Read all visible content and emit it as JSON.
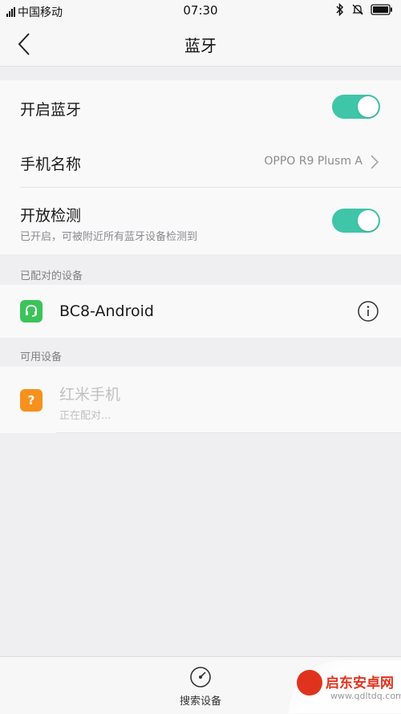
{
  "status_bar": {
    "carrier": "中国移动",
    "time": "07:30"
  },
  "nav": {
    "title": "蓝牙"
  },
  "settings": {
    "bluetooth": {
      "label": "开启蓝牙",
      "enabled": true
    },
    "phone_name": {
      "label": "手机名称",
      "value": "OPPO R9 Plusm A"
    },
    "visibility": {
      "label": "开放检测",
      "sub": "已开启，可被附近所有蓝牙设备检测到",
      "enabled": true
    }
  },
  "paired": {
    "header": "已配对的设备",
    "devices": [
      {
        "name": "BC8-Android",
        "icon": "headset-icon"
      }
    ]
  },
  "available": {
    "header": "可用设备",
    "devices": [
      {
        "name": "红米手机",
        "status": "正在配对...",
        "icon": "unknown-device-icon"
      }
    ]
  },
  "bottom": {
    "scan_label": "搜索设备"
  },
  "watermark": {
    "text": "启东安卓网",
    "url": "www.qdltdq.com"
  },
  "colors": {
    "accent": "#3fc5a8",
    "paired_icon": "#3cc35a",
    "available_icon": "#f5911e",
    "disabled_text": "#c1c1c3"
  }
}
